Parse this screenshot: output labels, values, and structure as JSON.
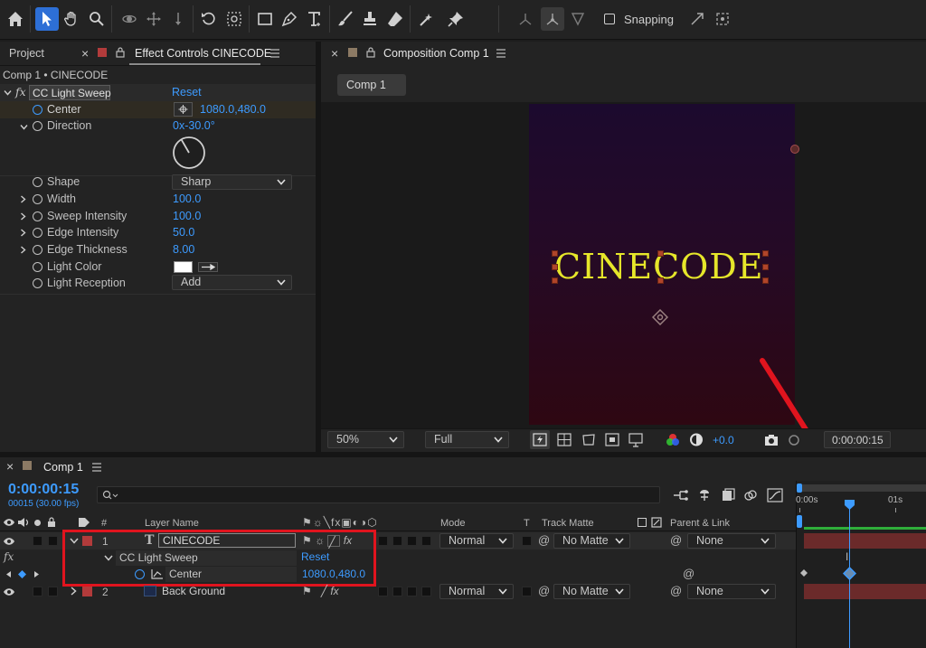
{
  "toolbar": {
    "snapping_label": "Snapping",
    "tools": [
      "home-icon",
      "selection-tool-icon",
      "hand-tool-icon",
      "zoom-tool-icon",
      "orbit-camera-icon",
      "pan-camera-icon",
      "dolly-camera-icon",
      "rotation-tool-icon",
      "pan-behind-icon",
      "rectangle-tool-icon",
      "pen-tool-icon",
      "type-tool-icon",
      "brush-tool-icon",
      "clone-stamp-icon",
      "eraser-tool-icon",
      "roto-brush-icon",
      "puppet-pin-icon"
    ]
  },
  "left_panel": {
    "tab_project": "Project",
    "tab_effect_controls": "Effect Controls CINECODE",
    "breadcrumb": "Comp 1 • CINECODE",
    "effect": {
      "fx": "fx",
      "name": "CC Light Sweep",
      "reset": "Reset"
    },
    "props": {
      "center": {
        "label": "Center",
        "value": "1080.0,480.0"
      },
      "direction": {
        "label": "Direction",
        "value": "0x-30.0°"
      },
      "shape": {
        "label": "Shape",
        "value": "Sharp"
      },
      "width": {
        "label": "Width",
        "value": "100.0"
      },
      "sweep_intensity": {
        "label": "Sweep Intensity",
        "value": "100.0"
      },
      "edge_intensity": {
        "label": "Edge Intensity",
        "value": "50.0"
      },
      "edge_thickness": {
        "label": "Edge Thickness",
        "value": "8.00"
      },
      "light_color": {
        "label": "Light Color",
        "color": "#ffffff"
      },
      "light_reception": {
        "label": "Light Reception",
        "value": "Add"
      }
    }
  },
  "viewer": {
    "tab": "Composition Comp 1",
    "comp_button": "Comp 1",
    "text_layer": "CINECODE",
    "zoom": "50%",
    "resolution": "Full",
    "exposure": "+0.0",
    "timecode": "0:00:00:15"
  },
  "timeline": {
    "tab": "Comp 1",
    "timecode": "0:00:00:15",
    "frames": "00015 (30.00 fps)",
    "headers": {
      "number": "#",
      "layer_name": "Layer Name",
      "mode": "Mode",
      "t": "T",
      "track_matte": "Track Matte",
      "parent": "Parent & Link"
    },
    "ruler": {
      "start": "0:00s",
      "mark_1": "01s"
    },
    "layers": [
      {
        "num": "1",
        "type": "T",
        "name": "CINECODE",
        "mode": "Normal",
        "matte": "No Matte",
        "parent": "None",
        "label_color": "#b23b3b"
      },
      {
        "num": "2",
        "type": "",
        "name": "Back Ground",
        "mode": "Normal",
        "matte": "No Matte",
        "parent": "None",
        "label_color": "#b23b3b"
      }
    ],
    "effect_row": {
      "fx": "fx",
      "name": "CC Light Sweep",
      "reset": "Reset"
    },
    "center_row": {
      "label": "Center",
      "value": "1080.0,480.0"
    }
  },
  "colors": {
    "accent_blue": "#3d9bff",
    "highlight_red": "#e0141e",
    "text_yellow": "#e6e62a",
    "layer_bar": "#6b2a2a"
  }
}
